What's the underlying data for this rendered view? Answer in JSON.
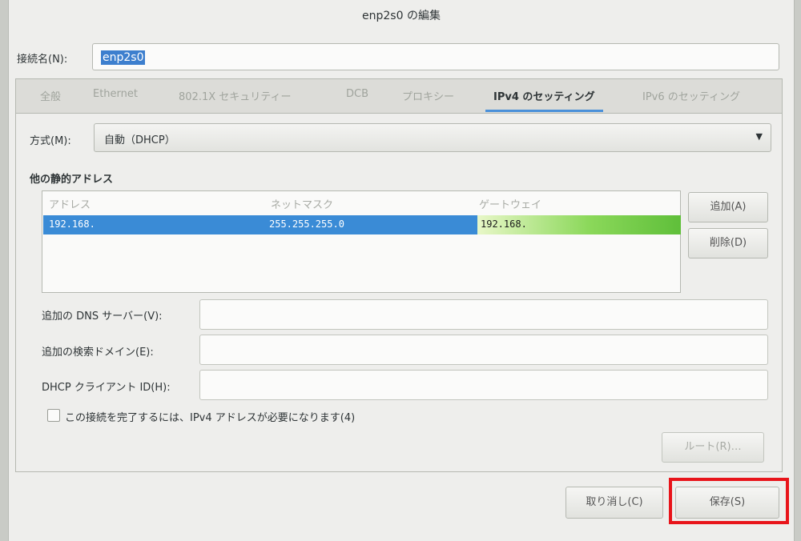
{
  "window": {
    "title": "enp2s0 の編集"
  },
  "connection": {
    "label": "接続名(N):",
    "value": "enp2s0"
  },
  "tabs": [
    {
      "label": "全般"
    },
    {
      "label": "Ethernet"
    },
    {
      "label": "802.1X セキュリティー"
    },
    {
      "label": "DCB"
    },
    {
      "label": "プロキシー"
    },
    {
      "label": "IPv4 のセッティング"
    },
    {
      "label": "IPv6 のセッティング"
    }
  ],
  "active_tab": "IPv4 のセッティング",
  "method": {
    "label": "方式(M):",
    "value": "自動（DHCP）",
    "arrow": "▼"
  },
  "addresses": {
    "title": "他の静的アドレス",
    "columns": [
      "アドレス",
      "ネットマスク",
      "ゲートウェイ"
    ],
    "rows": [
      {
        "address": "192.168.",
        "netmask": "255.255.255.0",
        "gateway": "192.168."
      }
    ],
    "add_label": "追加(A)",
    "delete_label": "削除(D)"
  },
  "fields": {
    "dns_label": "追加の DNS サーバー(V):",
    "search_label": "追加の検索ドメイン(E):",
    "dhcp_label": "DHCP クライアント ID(H):"
  },
  "require_ipv4": {
    "label": "この接続を完了するには、IPv4 アドレスが必要になります(4)",
    "checked": false
  },
  "route_label": "ルート(R)…",
  "footer": {
    "cancel_label": "取り消し(C)",
    "save_label": "保存(S)"
  },
  "colors": {
    "selection": "#3a8bd6",
    "highlight": "#e8141a",
    "tab_indicator": "#4a90d9"
  }
}
